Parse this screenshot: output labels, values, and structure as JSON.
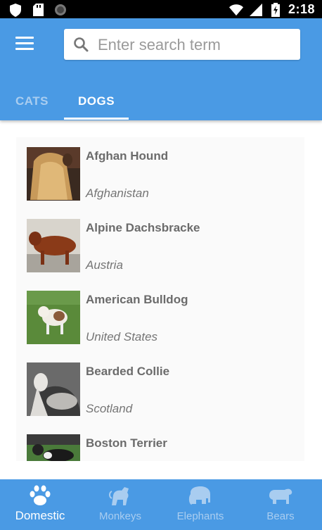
{
  "status_bar": {
    "time": "2:18",
    "icons": [
      "shield-icon",
      "sd-card-icon",
      "circle-icon",
      "wifi-icon",
      "signal-icon",
      "battery-charging-icon"
    ]
  },
  "search": {
    "placeholder": "Enter search term",
    "value": ""
  },
  "tabs": [
    {
      "label": "CATS",
      "selected": false
    },
    {
      "label": "DOGS",
      "selected": true
    }
  ],
  "list": [
    {
      "name": "Afghan Hound",
      "origin": "Afghanistan"
    },
    {
      "name": "Alpine Dachsbracke",
      "origin": "Austria"
    },
    {
      "name": "American Bulldog",
      "origin": "United States"
    },
    {
      "name": "Bearded Collie",
      "origin": "Scotland"
    },
    {
      "name": "Boston Terrier",
      "origin": ""
    }
  ],
  "bottom_nav": [
    {
      "label": "Domestic",
      "icon": "paw-icon",
      "active": true
    },
    {
      "label": "Monkeys",
      "icon": "monkey-icon",
      "active": false
    },
    {
      "label": "Elephants",
      "icon": "elephant-icon",
      "active": false
    },
    {
      "label": "Bears",
      "icon": "bear-icon",
      "active": false
    }
  ],
  "colors": {
    "primary": "#4a9ae4",
    "tab_inactive": "#a9cdf0",
    "status_bar": "#000000"
  }
}
